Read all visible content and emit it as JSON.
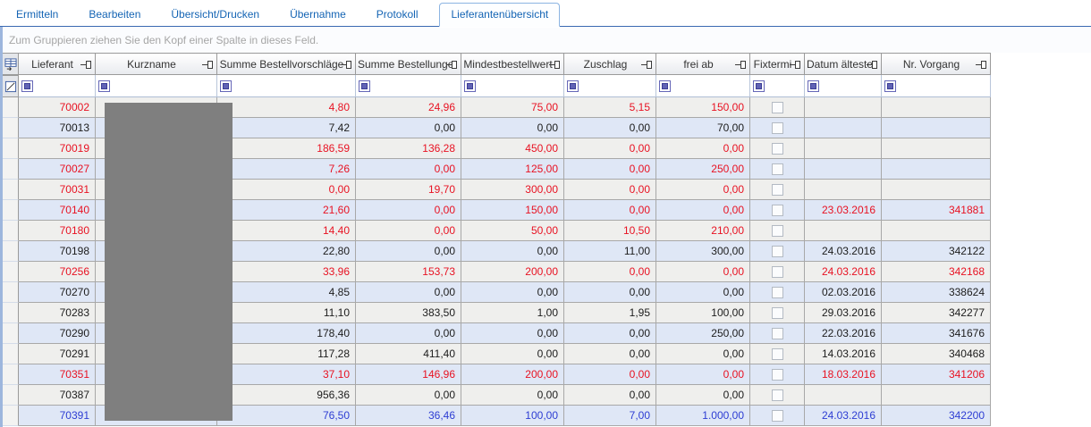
{
  "tabs": {
    "items": [
      {
        "label": "Ermitteln"
      },
      {
        "label": "Bearbeiten"
      },
      {
        "label": "Übersicht/Drucken"
      },
      {
        "label": "Übernahme"
      },
      {
        "label": "Protokoll"
      },
      {
        "label": "Lieferantenübersicht"
      }
    ],
    "active_label": "Lieferantenübersicht"
  },
  "group_panel": {
    "hint": "Zum Gruppieren ziehen Sie den Kopf einer Spalte in dieses Feld."
  },
  "icons": {
    "corner_header": "group-by-grid-icon",
    "corner_filter": "filter-edit-icon",
    "header_pin": "pin-icon",
    "filter_operator": "filter-operator-icon"
  },
  "colors": {
    "tab_text": "#1464b4",
    "tab_underline": "#3968b1",
    "row_alt": "#dfe7f6",
    "row_normal": "#efefed",
    "text_red": "#e81222",
    "text_selected_blue": "#2d3dd3",
    "redaction_gray": "#7f7f7f"
  },
  "grid": {
    "columns": [
      {
        "key": "lieferant",
        "label": "Lieferant"
      },
      {
        "key": "kurzname",
        "label": "Kurzname"
      },
      {
        "key": "summe_bv",
        "label": "Summe Bestellvorschläge"
      },
      {
        "key": "summe_best",
        "label": "Summe Bestellunge"
      },
      {
        "key": "mindest",
        "label": "Mindestbestellwert"
      },
      {
        "key": "zuschlag",
        "label": "Zuschlag"
      },
      {
        "key": "frei_ab",
        "label": "frei ab"
      },
      {
        "key": "fixtermin",
        "label": "Fixtermi"
      },
      {
        "key": "datum",
        "label": "Datum ältester"
      },
      {
        "key": "nr",
        "label": "Nr. Vorgang"
      }
    ],
    "rows": [
      {
        "lieferant": "70002",
        "kurzname": "",
        "summe_bv": "4,80",
        "summe_best": "24,96",
        "mindest": "75,00",
        "zuschlag": "5,15",
        "frei_ab": "150,00",
        "fixtermin": false,
        "datum": "",
        "nr": "",
        "state": "red"
      },
      {
        "lieferant": "70013",
        "kurzname": "",
        "summe_bv": "7,42",
        "summe_best": "0,00",
        "mindest": "0,00",
        "zuschlag": "0,00",
        "frei_ab": "70,00",
        "fixtermin": false,
        "datum": "",
        "nr": "",
        "state": "black"
      },
      {
        "lieferant": "70019",
        "kurzname": "",
        "summe_bv": "186,59",
        "summe_best": "136,28",
        "mindest": "450,00",
        "zuschlag": "0,00",
        "frei_ab": "0,00",
        "fixtermin": false,
        "datum": "",
        "nr": "",
        "state": "red"
      },
      {
        "lieferant": "70027",
        "kurzname": "",
        "summe_bv": "7,26",
        "summe_best": "0,00",
        "mindest": "125,00",
        "zuschlag": "0,00",
        "frei_ab": "250,00",
        "fixtermin": false,
        "datum": "",
        "nr": "",
        "state": "red"
      },
      {
        "lieferant": "70031",
        "kurzname": "",
        "summe_bv": "0,00",
        "summe_best": "19,70",
        "mindest": "300,00",
        "zuschlag": "0,00",
        "frei_ab": "0,00",
        "fixtermin": false,
        "datum": "",
        "nr": "",
        "state": "red"
      },
      {
        "lieferant": "70140",
        "kurzname": "",
        "summe_bv": "21,60",
        "summe_best": "0,00",
        "mindest": "150,00",
        "zuschlag": "0,00",
        "frei_ab": "0,00",
        "fixtermin": false,
        "datum": "23.03.2016",
        "nr": "341881",
        "state": "red"
      },
      {
        "lieferant": "70180",
        "kurzname": "",
        "summe_bv": "14,40",
        "summe_best": "0,00",
        "mindest": "50,00",
        "zuschlag": "10,50",
        "frei_ab": "210,00",
        "fixtermin": false,
        "datum": "",
        "nr": "",
        "state": "red"
      },
      {
        "lieferant": "70198",
        "kurzname": "",
        "summe_bv": "22,80",
        "summe_best": "0,00",
        "mindest": "0,00",
        "zuschlag": "11,00",
        "frei_ab": "300,00",
        "fixtermin": false,
        "datum": "24.03.2016",
        "nr": "342122",
        "state": "black"
      },
      {
        "lieferant": "70256",
        "kurzname": "",
        "summe_bv": "33,96",
        "summe_best": "153,73",
        "mindest": "200,00",
        "zuschlag": "0,00",
        "frei_ab": "0,00",
        "fixtermin": false,
        "datum": "24.03.2016",
        "nr": "342168",
        "state": "red"
      },
      {
        "lieferant": "70270",
        "kurzname": "",
        "summe_bv": "4,85",
        "summe_best": "0,00",
        "mindest": "0,00",
        "zuschlag": "0,00",
        "frei_ab": "0,00",
        "fixtermin": false,
        "datum": "02.03.2016",
        "nr": "338624",
        "state": "black"
      },
      {
        "lieferant": "70283",
        "kurzname": "",
        "summe_bv": "11,10",
        "summe_best": "383,50",
        "mindest": "1,00",
        "zuschlag": "1,95",
        "frei_ab": "100,00",
        "fixtermin": false,
        "datum": "29.03.2016",
        "nr": "342277",
        "state": "black"
      },
      {
        "lieferant": "70290",
        "kurzname": "",
        "summe_bv": "178,40",
        "summe_best": "0,00",
        "mindest": "0,00",
        "zuschlag": "0,00",
        "frei_ab": "250,00",
        "fixtermin": false,
        "datum": "22.03.2016",
        "nr": "341676",
        "state": "black"
      },
      {
        "lieferant": "70291",
        "kurzname": "",
        "summe_bv": "117,28",
        "summe_best": "411,40",
        "mindest": "0,00",
        "zuschlag": "0,00",
        "frei_ab": "0,00",
        "fixtermin": false,
        "datum": "14.03.2016",
        "nr": "340468",
        "state": "black"
      },
      {
        "lieferant": "70351",
        "kurzname": "",
        "summe_bv": "37,10",
        "summe_best": "146,96",
        "mindest": "200,00",
        "zuschlag": "0,00",
        "frei_ab": "0,00",
        "fixtermin": false,
        "datum": "18.03.2016",
        "nr": "341206",
        "state": "red"
      },
      {
        "lieferant": "70387",
        "kurzname": "",
        "summe_bv": "956,36",
        "summe_best": "0,00",
        "mindest": "0,00",
        "zuschlag": "0,00",
        "frei_ab": "0,00",
        "fixtermin": false,
        "datum": "",
        "nr": "",
        "state": "black"
      },
      {
        "lieferant": "70391",
        "kurzname": "",
        "summe_bv": "76,50",
        "summe_best": "36,46",
        "mindest": "100,00",
        "zuschlag": "7,00",
        "frei_ab": "1.000,00",
        "fixtermin": false,
        "datum": "24.03.2016",
        "nr": "342200",
        "state": "blue"
      }
    ]
  }
}
